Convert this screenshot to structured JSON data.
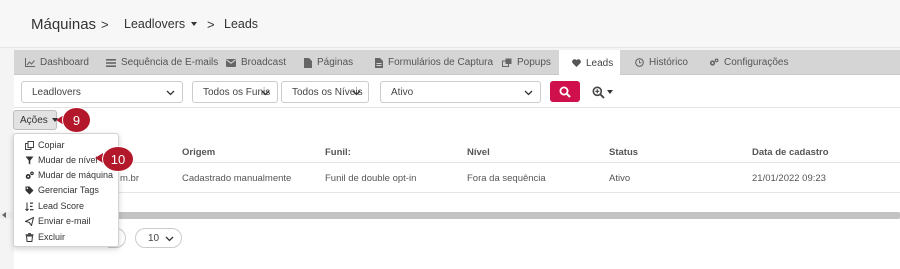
{
  "breadcrumb": {
    "title": "Máquinas",
    "separator": ">",
    "account": "Leadlovers",
    "page": "Leads"
  },
  "tabs": [
    {
      "label": "Dashboard",
      "icon": "chart-icon"
    },
    {
      "label": "Sequência de E-mails",
      "icon": "list-icon"
    },
    {
      "label": "Broadcast",
      "icon": "envelope-icon"
    },
    {
      "label": "Páginas",
      "icon": "page-icon"
    },
    {
      "label": "Formulários de Captura",
      "icon": "form-icon"
    },
    {
      "label": "Popups",
      "icon": "popup-icon"
    },
    {
      "label": "Leads",
      "icon": "heart-icon",
      "active": true
    },
    {
      "label": "Histórico",
      "icon": "history-icon"
    },
    {
      "label": "Configurações",
      "icon": "gears-icon"
    }
  ],
  "filters": {
    "machine": "Leadlovers",
    "funnel": "Todos os Funis",
    "level": "Todos os Níveis",
    "status": "Ativo"
  },
  "actions_button": "Ações",
  "callouts": {
    "one": "9",
    "two": "10"
  },
  "actions_menu": [
    {
      "label": "Copiar",
      "icon": "copy-icon"
    },
    {
      "label": "Mudar de nível",
      "icon": "filter-icon"
    },
    {
      "label": "Mudar de máquina",
      "icon": "gears-icon"
    },
    {
      "label": "Gerenciar Tags",
      "icon": "tags-icon"
    },
    {
      "label": "Lead Score",
      "icon": "sort-icon"
    },
    {
      "label": "Enviar e-mail",
      "icon": "send-icon"
    },
    {
      "label": "Excluir",
      "icon": "trash-icon"
    }
  ],
  "table": {
    "headers": [
      "Origem",
      "Funil:",
      "Nível",
      "Status",
      "Data de cadastro"
    ],
    "row": {
      "email_fragment": "m.br",
      "origin": "Cadastrado manualmente",
      "funnel": "Funil de double opt-in",
      "level": "Fora da sequência",
      "status": "Ativo",
      "date": "21/01/2022 09:23"
    }
  },
  "pagination": {
    "page_size": "10"
  },
  "colors": {
    "accent": "#d0104c",
    "callout": "#b3172a",
    "tabbar": "#d5d5d5"
  }
}
